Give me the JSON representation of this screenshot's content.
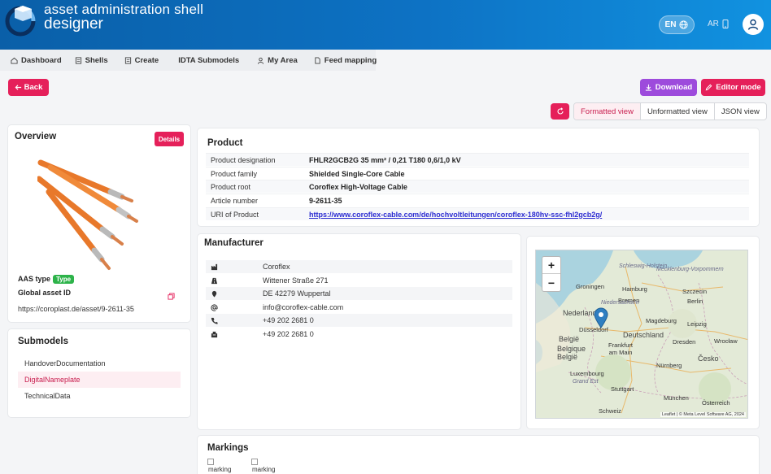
{
  "app": {
    "title_line1": "asset administration shell",
    "title_line2": "designer",
    "language": "EN",
    "ar_label": "AR"
  },
  "nav": {
    "items": [
      {
        "label": "Dashboard",
        "icon": "home-icon"
      },
      {
        "label": "Shells",
        "icon": "doc-icon"
      },
      {
        "label": "Create",
        "icon": "doc-icon"
      },
      {
        "label": "IDTA Submodels",
        "icon": ""
      },
      {
        "label": "My Area",
        "icon": "user-icon"
      },
      {
        "label": "Feed mapping",
        "icon": "file-icon"
      }
    ]
  },
  "toolbar": {
    "back_label": "Back",
    "download_label": "Download",
    "editor_label": "Editor mode",
    "views": [
      "Formatted view",
      "Unformatted view",
      "JSON view"
    ],
    "active_view": "Formatted view"
  },
  "overview": {
    "title": "Overview",
    "details_label": "Details",
    "aas_type_label": "AAS type",
    "aas_type_badge": "Type",
    "global_asset_id_label": "Global asset ID",
    "global_asset_id": "https://coroplast.de/asset/9-2611-35"
  },
  "submodels": {
    "title": "Submodels",
    "items": [
      "HandoverDocumentation",
      "DigitalNameplate",
      "TechnicalData"
    ],
    "active": "DigitalNameplate"
  },
  "product": {
    "title": "Product",
    "rows": [
      {
        "key": "Product designation",
        "value": "FHLR2GCB2G 35 mm² / 0,21 T180 0,6/1,0 kV"
      },
      {
        "key": "Product family",
        "value": "Shielded Single-Core Cable"
      },
      {
        "key": "Product root",
        "value": "Coroflex High-Voltage Cable"
      },
      {
        "key": "Article number",
        "value": "9-2611-35"
      },
      {
        "key": "URI of Product",
        "value": "https://www.coroflex-cable.com/de/hochvoltleitungen/coroflex-180hv-ssc-fhl2gcb2g/"
      }
    ]
  },
  "manufacturer": {
    "title": "Manufacturer",
    "rows": [
      {
        "icon": "factory-icon",
        "value": "Coroflex"
      },
      {
        "icon": "road-icon",
        "value": "Wittener Straße 271"
      },
      {
        "icon": "pin-icon",
        "value": "DE 42279 Wuppertal"
      },
      {
        "icon": "at-icon",
        "value": "info@coroflex-cable.com"
      },
      {
        "icon": "phone-icon",
        "value": "+49 202 2681 0"
      },
      {
        "icon": "fax-icon",
        "value": "+49 202 2681 0"
      }
    ]
  },
  "map": {
    "zoom_in": "+",
    "zoom_out": "−",
    "attribution": "Leaflet | © Meta Level Software AG, 2024",
    "labels": [
      "Schleswig-Holstein",
      "Mecklenburg-Vorpommern",
      "Hamburg",
      "Szczecin",
      "Groningen",
      "Bremen",
      "Berlin",
      "Niedersachsen",
      "Nederland",
      "Magdeburg",
      "Deutschland",
      "Düsseldorf",
      "België",
      "Belgique",
      "België",
      "Leipzig",
      "Dresden",
      "Wrocław",
      "Frankfurt am Main",
      "Luxembourg",
      "Nürnberg",
      "Česko",
      "Grand Est",
      "Stuttgart",
      "München",
      "Österreich",
      "Schweiz"
    ]
  },
  "markings": {
    "title": "Markings",
    "images": [
      "marking",
      "marking"
    ]
  }
}
